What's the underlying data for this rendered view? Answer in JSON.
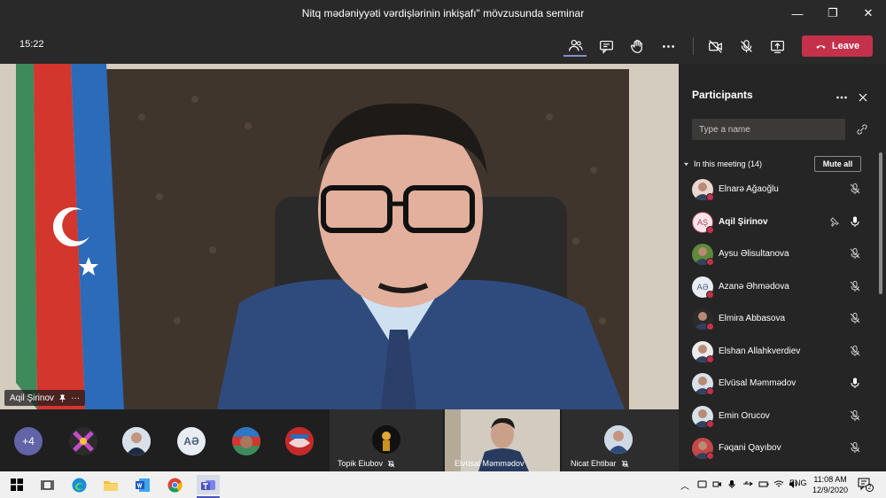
{
  "window": {
    "title": "Nitq mədəniyyəti vərdişlərinin inkişafı\" mövzusunda seminar",
    "minimize": "—",
    "maximize": "❐",
    "close": "✕"
  },
  "toolbar": {
    "time": "15:22",
    "leave_label": "Leave",
    "icons": [
      "participants-icon",
      "chat-icon",
      "raise-hand-icon",
      "more-icon",
      "camera-off-icon",
      "mic-off-icon",
      "share-icon"
    ]
  },
  "main_video": {
    "speaker_name": "Aqil Şirinov",
    "more": "···"
  },
  "strip": {
    "overflow_count": "+4",
    "avatar_initials": "AƏ",
    "tiles": [
      {
        "name": "Topik Eiubov"
      },
      {
        "name": "Elvüsal Məmmədov"
      },
      {
        "name": "Nicat Ehtibar"
      }
    ]
  },
  "panel": {
    "title": "Participants",
    "search_placeholder": "Type a name",
    "section_label": "In this meeting (14)",
    "mute_all_label": "Mute all",
    "participants": [
      {
        "name": "Elnarə Ağaoğlu",
        "initials": "",
        "mic": "muted",
        "bold": false
      },
      {
        "name": "Aqil Şirinov",
        "initials": "AŞ",
        "mic": "on",
        "bold": true,
        "pinned": true
      },
      {
        "name": "Aysu Əlisultanova",
        "initials": "",
        "mic": "muted",
        "bold": false
      },
      {
        "name": "Azanə Əhmədova",
        "initials": "AƏ",
        "mic": "muted",
        "bold": false
      },
      {
        "name": "Elmira Abbasova",
        "initials": "",
        "mic": "muted",
        "bold": false
      },
      {
        "name": "Elshan Allahkverdiev",
        "initials": "",
        "mic": "muted",
        "bold": false
      },
      {
        "name": "Elvüsal Məmmədov",
        "initials": "",
        "mic": "on",
        "bold": false
      },
      {
        "name": "Emin Orucov",
        "initials": "",
        "mic": "muted",
        "bold": false
      },
      {
        "name": "Fəqani Qayıbov",
        "initials": "",
        "mic": "muted",
        "bold": false
      }
    ]
  },
  "taskbar": {
    "lang": "ENG",
    "time": "11:08 AM",
    "date": "12/9/2020",
    "notification_count": "2"
  },
  "colors": {
    "leave": "#c4314b",
    "accent": "#8b8cc7",
    "panel_bg": "#252525"
  }
}
